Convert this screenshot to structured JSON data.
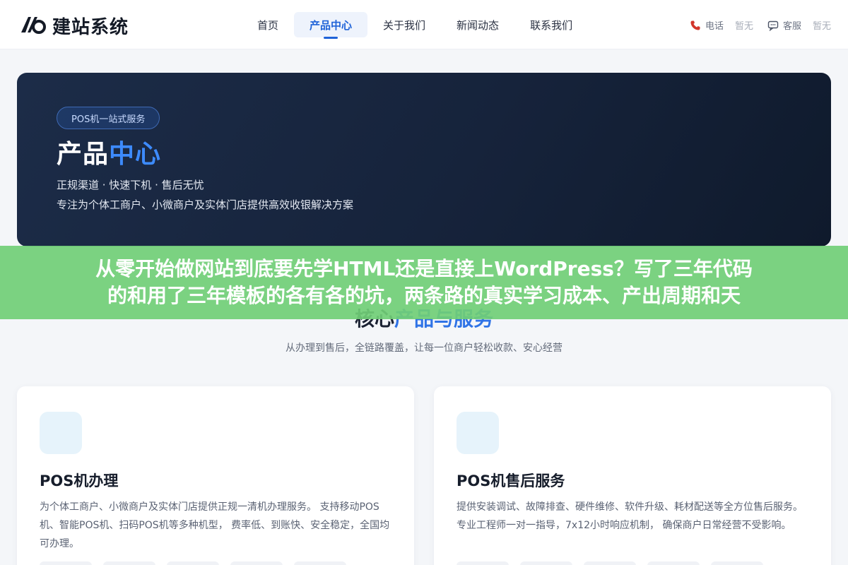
{
  "header": {
    "logo_text": "建站系统",
    "nav": [
      {
        "label": "首页",
        "active": false
      },
      {
        "label": "产品中心",
        "active": true
      },
      {
        "label": "关于我们",
        "active": false
      },
      {
        "label": "新闻动态",
        "active": false
      },
      {
        "label": "联系我们",
        "active": false
      }
    ],
    "phone_label": "电话",
    "phone_value": "暂无",
    "service_label": "客服",
    "service_value": "暂无"
  },
  "hero": {
    "badge": "POS机一站式服务",
    "title_main": "产品",
    "title_accent": "中心",
    "line1": "正规渠道 · 快速下机 · 售后无忧",
    "line2": "专注为个体工商户、小微商户及实体门店提供高效收银解决方案"
  },
  "overlay": {
    "line1": "从零开始做网站到底要先学HTML还是直接上WordPress？写了三年代码",
    "line2": "的和用了三年模板的各有各的坑，两条路的真实学习成本、产出周期和天"
  },
  "section": {
    "title_main": "核心",
    "title_accent": "产品与服务",
    "subtitle": "从办理到售后，全链路覆盖，让每一位商户轻松收款、安心经营"
  },
  "cards": [
    {
      "title": "POS机办理",
      "desc": "为个体工商户、小微商户及实体门店提供正规一清机办理服务。 支持移动POS机、智能POS机、扫码POS机等多种机型， 费率低、到账快、安全稳定，全国均可办理。"
    },
    {
      "title": "POS机售后服务",
      "desc": "提供安装调试、故障排查、硬件维修、软件升级、耗材配送等全方位售后服务。 专业工程师一对一指导，7x12小时响应机制， 确保商户日常经营不受影响。"
    }
  ],
  "colors": {
    "accent": "#1f63d8",
    "hero_bg": "#16233b",
    "overlay_green": "#70ce76"
  }
}
